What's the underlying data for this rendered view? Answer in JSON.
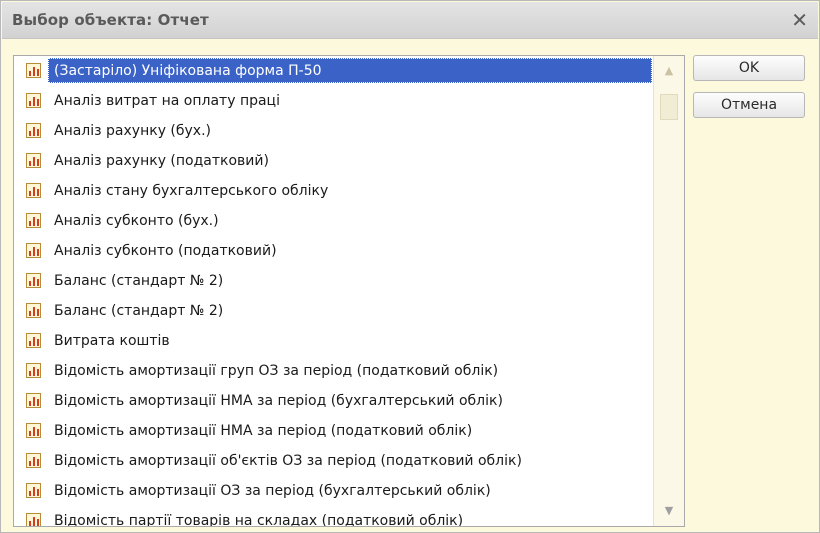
{
  "window": {
    "title": "Выбор объекта: Отчет",
    "close_glyph": "✕"
  },
  "buttons": {
    "ok": "OK",
    "cancel": "Отмена"
  },
  "list": {
    "selected_index": 0,
    "icon": "report-chart-icon",
    "items": [
      "(Застаріло) Уніфікована форма П-50",
      "Аналіз витрат на оплату праці",
      "Аналіз рахунку (бух.)",
      "Аналіз рахунку (податковий)",
      "Аналіз стану бухгалтерського обліку",
      "Аналіз субконто (бух.)",
      "Аналіз субконто (податковий)",
      "Баланс (стандарт № 2)",
      "Баланс (стандарт № 2)",
      "Витрата коштів",
      "Відомість амортизації груп ОЗ за період (податковий облік)",
      "Відомість амортизації НМА за період (бухгалтерський облік)",
      "Відомість амортизації НМА за період (податковий облік)",
      "Відомість амортизації об'єктів ОЗ за період (податковий облік)",
      "Відомість амортизації ОЗ за період (бухгалтерський облік)",
      "Відомість партії товарів на складах (податковий облік)"
    ]
  },
  "scrollbar": {
    "up_glyph": "▲",
    "down_glyph": "▼"
  }
}
